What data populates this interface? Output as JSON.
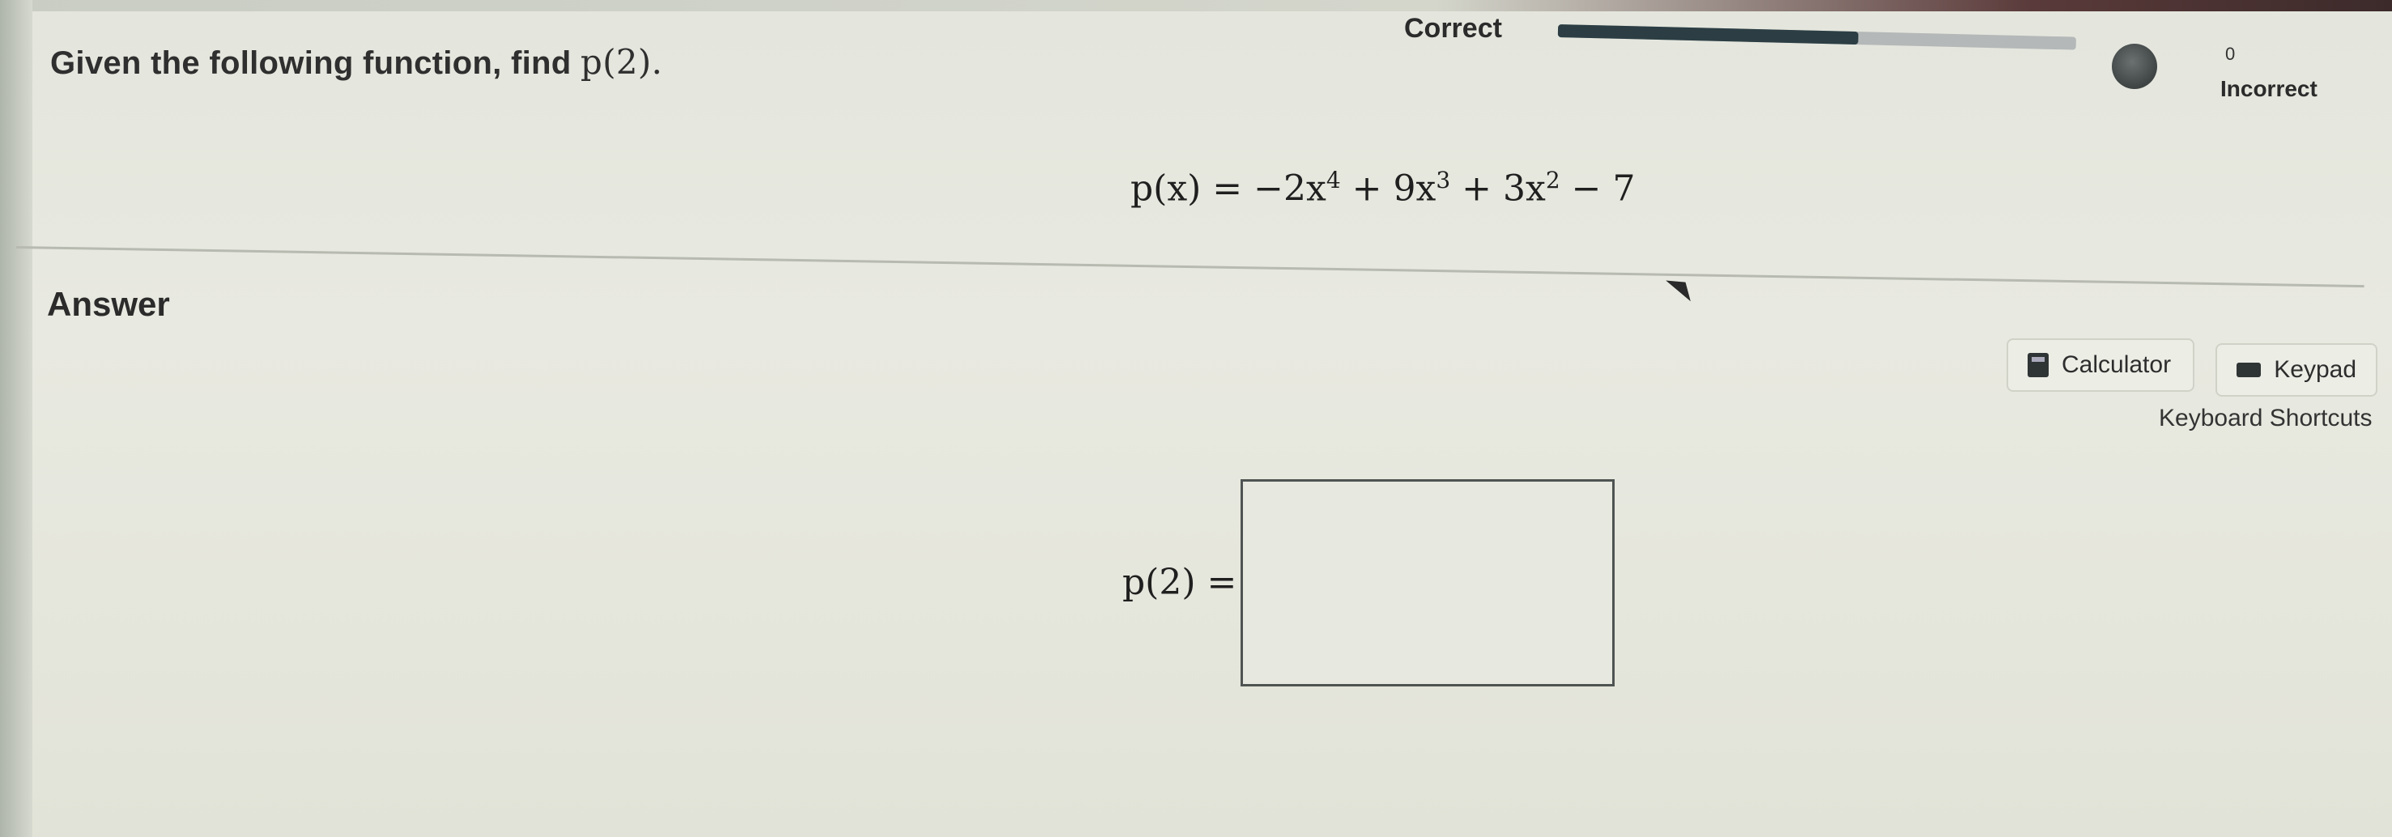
{
  "question": {
    "prompt_text": "Given the following function, find",
    "prompt_math": "p(2).",
    "equation": {
      "lhs": "p(x) = ",
      "t1": "−2x",
      "e1": "4",
      "t2": " + 9x",
      "e2": "3",
      "t3": " + 3x",
      "e3": "2",
      "t4": " − 7"
    }
  },
  "status": {
    "correct_label": "Correct",
    "progress_fraction": 0.58,
    "incorrect_count": "0",
    "incorrect_label": "Incorrect"
  },
  "answer": {
    "heading": "Answer",
    "label": "p(2) =",
    "value": ""
  },
  "tools": {
    "calculator_label": "Calculator",
    "keypad_label": "Keypad",
    "shortcuts_label": "Keyboard Shortcuts"
  },
  "icons": {
    "status": "progress-ring-icon",
    "calculator": "calculator-icon",
    "keypad": "keypad-icon",
    "pointer": "mouse-cursor-icon"
  }
}
